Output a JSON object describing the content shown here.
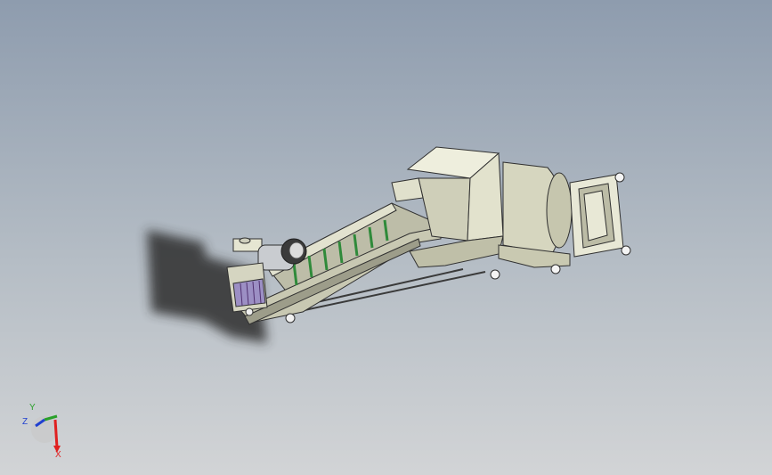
{
  "viewport": {
    "background_top": "#8e9cae",
    "background_bottom": "#d2d4d6"
  },
  "model": {
    "body_color": "#d6d6bf",
    "shadow_color": "#2e2e2e",
    "slat_color": "#2f8a3a",
    "motor_color": "#cfd2d6",
    "panel_color": "#9c8fc4"
  },
  "triad": {
    "x_label": "X",
    "y_label": "Y",
    "z_label": "Z",
    "x_color": "#e02020",
    "y_color": "#2aa02a",
    "z_color": "#2040d0"
  }
}
